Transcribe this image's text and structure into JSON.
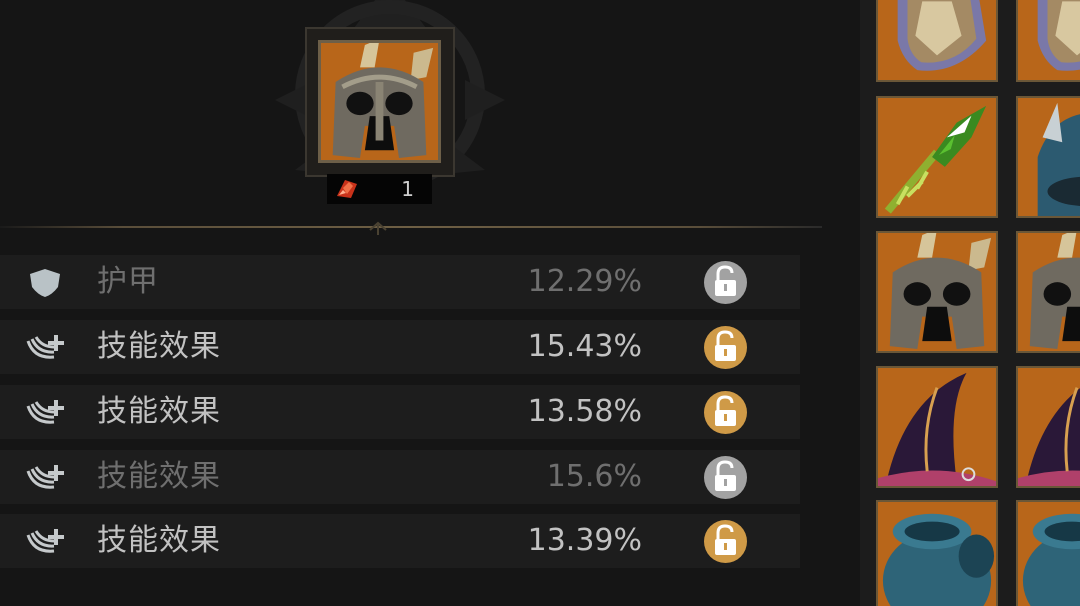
{
  "featured_item": {
    "icon": "horned-helmet-icon",
    "cost_icon": "red-crystal-icon",
    "cost_value": "1"
  },
  "stats": [
    {
      "icon": "shield-icon",
      "name": "护甲",
      "value": "12.29%",
      "lock": "unlocked-grey",
      "state": "dim"
    },
    {
      "icon": "skill-effect-icon",
      "name": "技能效果",
      "value": "15.43%",
      "lock": "unlocked-gold",
      "state": "active"
    },
    {
      "icon": "skill-effect-icon",
      "name": "技能效果",
      "value": "13.58%",
      "lock": "unlocked-gold",
      "state": "active"
    },
    {
      "icon": "skill-effect-icon",
      "name": "技能效果",
      "value": "15.6%",
      "lock": "unlocked-grey",
      "state": "dim"
    },
    {
      "icon": "skill-effect-icon",
      "name": "技能效果",
      "value": "13.39%",
      "lock": "unlocked-gold",
      "state": "active"
    }
  ],
  "inventory": [
    {
      "icon": "shield-icon"
    },
    {
      "icon": "shield-icon"
    },
    {
      "icon": "green-staff-icon"
    },
    {
      "icon": "blue-helmet-icon"
    },
    {
      "icon": "horned-helmet-icon"
    },
    {
      "icon": "horned-helmet-icon"
    },
    {
      "icon": "witch-hat-icon"
    },
    {
      "icon": "witch-hat-icon"
    },
    {
      "icon": "pauldron-icon"
    },
    {
      "icon": "pauldron-icon"
    }
  ],
  "colors": {
    "background": "#151515",
    "row_background": "#1d1d1d",
    "slot_orange": "#b8661a",
    "lock_gold": "#cf9a47",
    "lock_grey": "#a2a2a2",
    "text_active": "#c2c2c2",
    "text_dim": "#6f6f6f"
  }
}
